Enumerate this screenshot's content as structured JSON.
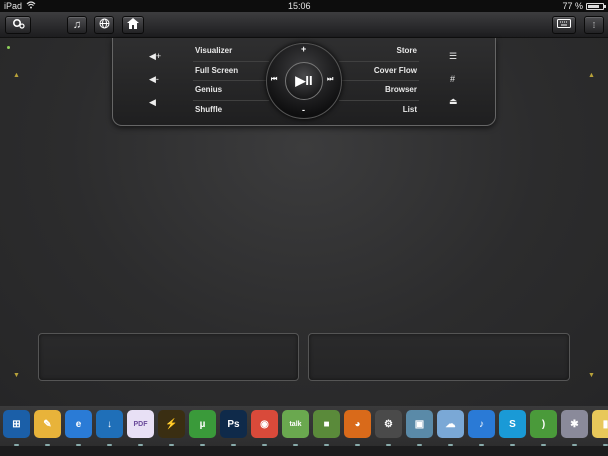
{
  "status": {
    "device": "iPad",
    "time": "15:06",
    "battery": "77 %",
    "battery_level": 0.77
  },
  "toolbar": {
    "settings_icon": "gear-icon",
    "music_icon": "music-note-icon",
    "globe_icon": "globe-icon",
    "home_icon": "home-icon",
    "keyboard_icon": "keyboard-icon",
    "more_icon": "more-icon"
  },
  "panel": {
    "left_labels": [
      "Visualizer",
      "Full Screen",
      "Genius",
      "Shuffle"
    ],
    "right_labels": [
      "Store",
      "Cover Flow",
      "Browser",
      "List"
    ],
    "wheel": {
      "plus": "+",
      "minus": "-",
      "play_pause": "▶II",
      "prev": "⏮",
      "next": "⏭"
    }
  },
  "dock": {
    "apps": [
      {
        "name": "windows-start",
        "glyph": "⊞",
        "bg": "#1b5fa8"
      },
      {
        "name": "paint",
        "glyph": "✎",
        "bg": "#e8b33a"
      },
      {
        "name": "internet-explorer",
        "glyph": "e",
        "bg": "#2a7bd6"
      },
      {
        "name": "downloader",
        "glyph": "↓",
        "bg": "#1f6fb8"
      },
      {
        "name": "pdf-tool",
        "glyph": "PDF",
        "bg": "#e8e0f5"
      },
      {
        "name": "winamp",
        "glyph": "⚡",
        "bg": "#3a2e12"
      },
      {
        "name": "utorrent",
        "glyph": "µ",
        "bg": "#3a9a3a"
      },
      {
        "name": "photoshop",
        "glyph": "Ps",
        "bg": "#0f2a4a"
      },
      {
        "name": "chrome",
        "glyph": "◉",
        "bg": "#d94a3a"
      },
      {
        "name": "google-talk",
        "glyph": "talk",
        "bg": "#6aa84f"
      },
      {
        "name": "minecraft",
        "glyph": "■",
        "bg": "#5a8a3a"
      },
      {
        "name": "firefox",
        "glyph": "◕",
        "bg": "#d96a1a"
      },
      {
        "name": "steam",
        "glyph": "⚙",
        "bg": "#4a4a4a"
      },
      {
        "name": "remote-desktop",
        "glyph": "▣",
        "bg": "#5a8aa8"
      },
      {
        "name": "network",
        "glyph": "☁",
        "bg": "#7aa8d6"
      },
      {
        "name": "itunes",
        "glyph": "♪",
        "bg": "#2a7ad6"
      },
      {
        "name": "skype",
        "glyph": "S",
        "bg": "#1a9ad6"
      },
      {
        "name": "rss-reader",
        "glyph": ")",
        "bg": "#4a9a3a"
      },
      {
        "name": "system-tools",
        "glyph": "✱",
        "bg": "#8a8a9a"
      },
      {
        "name": "folder",
        "glyph": "▮",
        "bg": "#e8c85a"
      }
    ]
  },
  "colors": {
    "accent_arrow": "#b8a23a",
    "panel_border": "#666666"
  }
}
